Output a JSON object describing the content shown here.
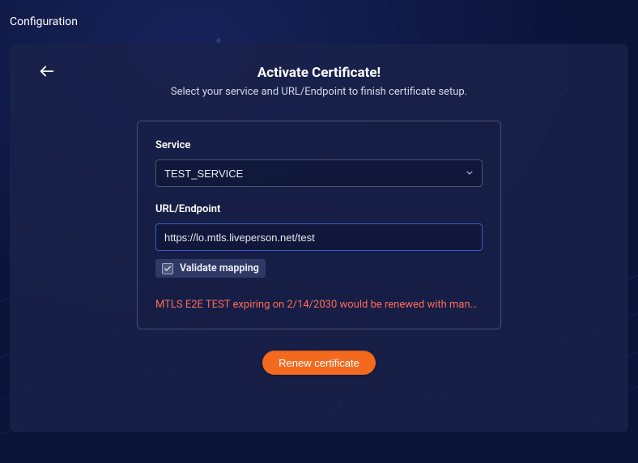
{
  "topbar": {
    "title": "Configuration"
  },
  "header": {
    "title": "Activate Certificate!",
    "subtitle": "Select your service and URL/Endpoint to finish certificate setup."
  },
  "form": {
    "service_label": "Service",
    "service_value": "TEST_SERVICE",
    "url_label": "URL/Endpoint",
    "url_value": "https://lo.mtls.liveperson.net/test",
    "validate_label": "Validate mapping",
    "validate_checked": true,
    "warning": "MTLS E2E TEST expiring on 2/14/2030 would be renewed with man…"
  },
  "actions": {
    "primary_label": "Renew certificate"
  }
}
